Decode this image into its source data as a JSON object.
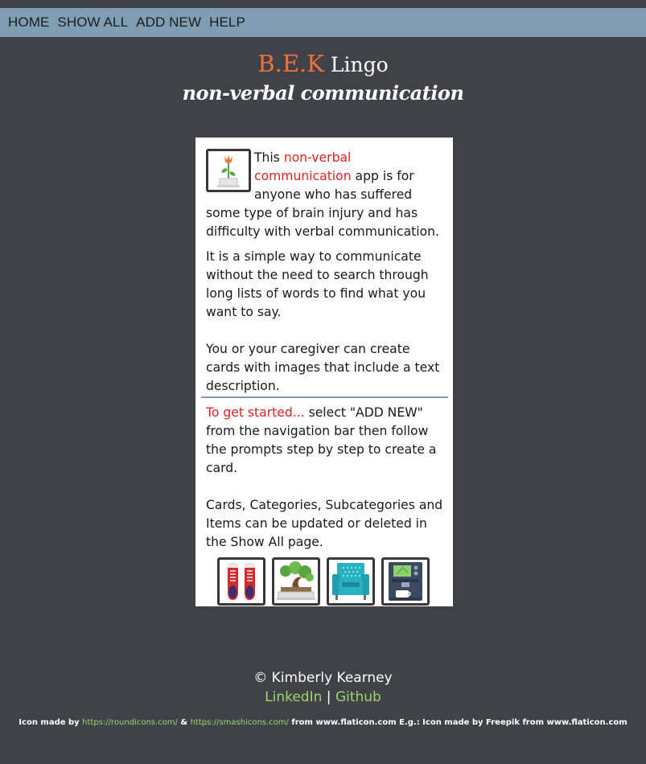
{
  "nav": {
    "items": [
      {
        "label": "HOME"
      },
      {
        "label": "SHOW ALL"
      },
      {
        "label": "ADD NEW"
      },
      {
        "label": "HELP"
      }
    ]
  },
  "header": {
    "brand_accent": "B.E.K",
    "brand_rest": " Lingo",
    "subtitle": "non-verbal communication"
  },
  "card": {
    "intro_icon": "plant-pot-icon",
    "para1_pre": "This ",
    "para1_accent": "non-verbal communication",
    "para1_post": " app is for anyone who has suffered some type of brain injury and has difficulty with verbal communication.",
    "para2": "It is a simple way to communicate without the need to search through long lists of words to find what you want to say.",
    "para3": "You or your caregiver can create cards with images that include a text description.",
    "para4_accent": "To get started...",
    "para4_post": " select \"ADD NEW\" from the navigation bar then follow the prompts step by step to create a card.",
    "para5": "Cards, Categories, Subcategories and Items can be updated or deleted in the Show All page.",
    "icons": [
      "shoes-icon",
      "bonsai-icon",
      "armchair-icon",
      "coffee-machine-icon"
    ]
  },
  "footer": {
    "copyright": "© Kimberly Kearney",
    "linkedin": "LinkedIn",
    "separator": "|",
    "github": "Github",
    "credit_pre": "Icon made by ",
    "credit_link1": "https://roundicons.com/",
    "credit_amp": " & ",
    "credit_link2": "https://smashicons.com/",
    "credit_post": " from www.flaticon.com E.g.: Icon made by Freepik from www.flaticon.com"
  },
  "colors": {
    "background": "#414249",
    "navbar": "#7f9db3",
    "brand_accent": "#f0743a",
    "text_accent": "#e0221f",
    "link_green": "#9cd66a"
  }
}
